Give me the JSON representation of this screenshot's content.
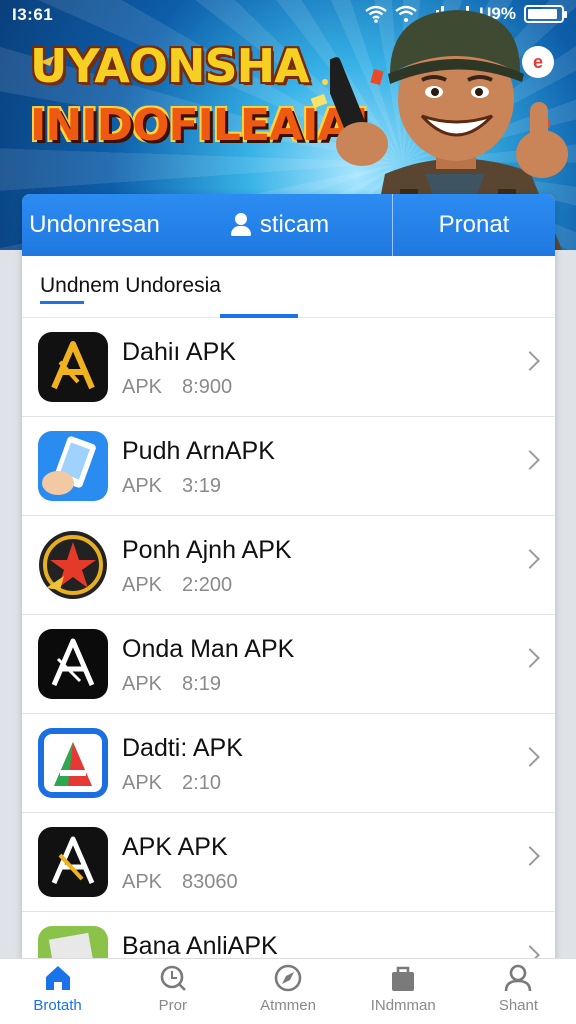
{
  "status_bar": {
    "time": "I3:61",
    "battery_percent": "U9%",
    "battery_level": 0.9
  },
  "banner": {
    "title_line1": "UYAONSHA",
    "title_line2": "INIDOFILEAIA!",
    "badge_text": "e"
  },
  "tabs": [
    {
      "label": "Undonresan"
    },
    {
      "label": "sticam",
      "icon": "user-icon"
    },
    {
      "label": "Pronat"
    }
  ],
  "subheader": {
    "label": "Undnem Undoresia"
  },
  "apps": [
    {
      "name": "Dahiı APK",
      "meta_type": "APK",
      "meta_value": "8:900",
      "icon": "apk-a-gold-icon"
    },
    {
      "name": "Pudh ArnAPK",
      "meta_type": "APK",
      "meta_value": "3:19",
      "icon": "hand-phone-icon"
    },
    {
      "name": "Ponh Ajnh APK",
      "meta_type": "APK",
      "meta_value": "2:200",
      "icon": "rocket-badge-icon"
    },
    {
      "name": "Onda Man APK",
      "meta_type": "APK",
      "meta_value": "8:19",
      "icon": "apk-a-white-icon"
    },
    {
      "name": "Dadti: APK",
      "meta_type": "APK",
      "meta_value": "2:10",
      "icon": "colorful-a-icon"
    },
    {
      "name": "APK APK",
      "meta_type": "APK",
      "meta_value": "83060",
      "icon": "apk-a-gold-icon"
    },
    {
      "name": "Bana AnliAPK",
      "meta_type": "",
      "meta_value": "",
      "icon": "green-app-icon"
    }
  ],
  "bottom_nav": [
    {
      "label": "Brotath",
      "icon": "home-icon",
      "active": true
    },
    {
      "label": "Pror",
      "icon": "search-icon",
      "active": false
    },
    {
      "label": "Atmmen",
      "icon": "compass-icon",
      "active": false
    },
    {
      "label": "INdmman",
      "icon": "bag-icon",
      "active": false
    },
    {
      "label": "Shant",
      "icon": "profile-icon",
      "active": false
    }
  ],
  "colors": {
    "accent": "#1a73e8",
    "tab_blue": "#2c8cf1",
    "title_yellow": "#f5d022",
    "title_orange": "#ee5a12"
  }
}
